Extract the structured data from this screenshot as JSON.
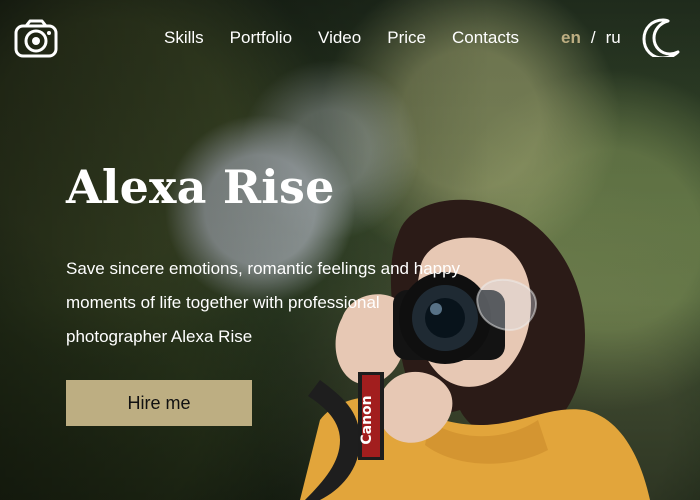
{
  "header": {
    "logo_icon": "camera-icon",
    "nav": [
      {
        "label": "Skills"
      },
      {
        "label": "Portfolio"
      },
      {
        "label": "Video"
      },
      {
        "label": "Price"
      },
      {
        "label": "Contacts"
      }
    ],
    "language": {
      "active": "en",
      "separator": "/",
      "other": "ru",
      "active_color": "#bdae82"
    },
    "theme_icon": "moon-icon"
  },
  "hero": {
    "title": "Alexa Rise",
    "subtitle": "Save sincere emotions, romantic feelings and happy moments of life together with professional photographer Alexa Rise",
    "cta_label": "Hire me",
    "cta_color": "#bdae82",
    "camera_strap_text": "Canon"
  }
}
